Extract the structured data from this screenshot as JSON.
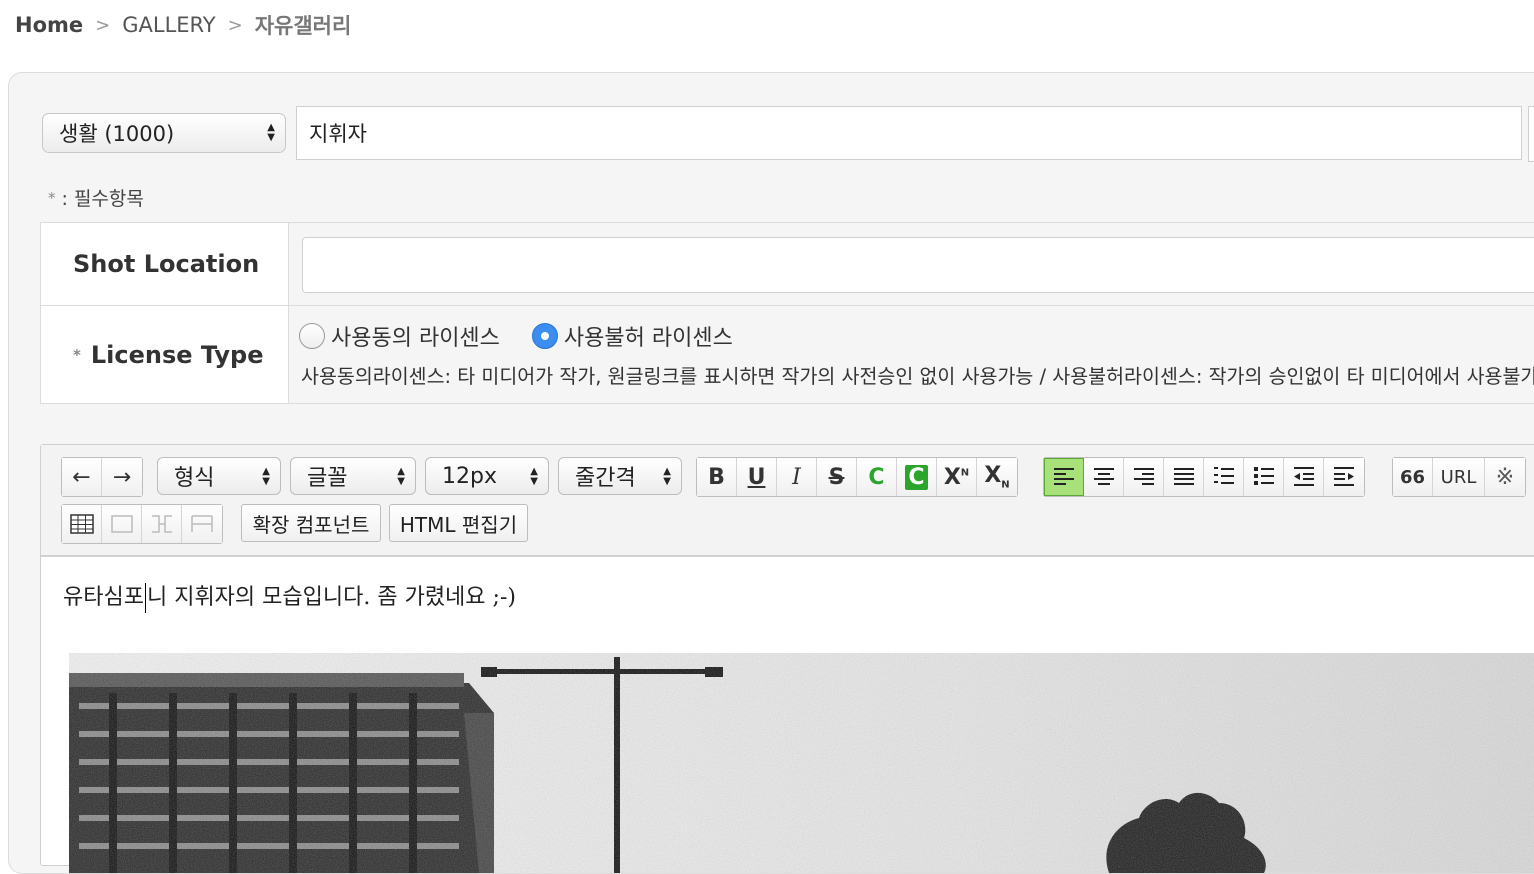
{
  "breadcrumb": {
    "home": "Home",
    "section": "GALLERY",
    "current": "자유갤러리",
    "separator": ">"
  },
  "category_select": {
    "value": "생활 (1000)"
  },
  "title_input": {
    "value": "지휘자"
  },
  "required_note": {
    "star": "*",
    "text": ": 필수항목"
  },
  "form": {
    "shot_location": {
      "label": "Shot Location",
      "value": ""
    },
    "license_type": {
      "label": "License Type",
      "star": "*",
      "options": [
        {
          "label": "사용동의 라이센스",
          "selected": false
        },
        {
          "label": "사용불허 라이센스",
          "selected": true
        }
      ],
      "description": "사용동의라이센스: 타 미디어가 작가, 원글링크를 표시하면 작가의 사전승인 없이 사용가능 / 사용불허라이센스: 작가의 승인없이 타 미디어에서 사용불가"
    }
  },
  "editor": {
    "toolbar": {
      "format_select": "형식",
      "font_select": "글꼴",
      "size_select": "12px",
      "line_height_select": "줄간격",
      "buttons": {
        "undo": "←",
        "redo": "→",
        "bold": "B",
        "underline": "U",
        "italic": "I",
        "strike": "S",
        "color": "C",
        "bgcolor": "C",
        "sup": "X",
        "sup_n": "N",
        "sub": "X",
        "sub_n": "N",
        "quote": "66",
        "url": "URL",
        "special": "※"
      },
      "extend_component": "확장 컴포넌트",
      "html_edit": "HTML 편집기"
    },
    "content_before_caret": "유타심포",
    "content_after_caret": "니 지휘자의 모습입니다. 좀 가렸네요 ;-)"
  },
  "colors": {
    "panel_bg": "#f5f5f5",
    "radio_selected": "#3b8df0",
    "active_align": "#a8e07a",
    "green": "#2ca52c"
  }
}
